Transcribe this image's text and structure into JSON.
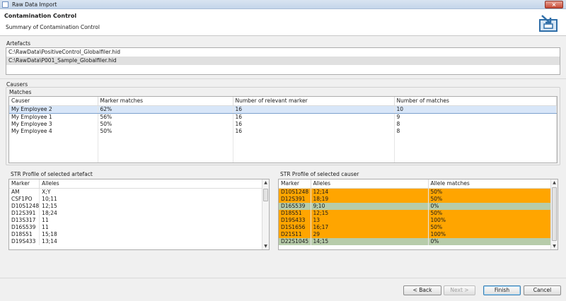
{
  "window": {
    "title": "Raw Data Import",
    "close_glyph": "×"
  },
  "header": {
    "title": "Contamination Control",
    "subtitle": "Summary of Contamination Control",
    "icon": "import-wizard-icon"
  },
  "artefacts": {
    "label": "Artefacts",
    "items": [
      "C:\\RawData\\PositiveControl_Globalfiler.hid",
      "C:\\RawData\\P001_Sample_Globalfiler.hid"
    ]
  },
  "causers": {
    "label": "Causers",
    "matches_label": "Matches",
    "columns": [
      "Causer",
      "Marker matches",
      "Number of relevant marker",
      "Number of matches"
    ],
    "rows": [
      [
        "My Employee 2",
        "62%",
        "16",
        "10"
      ],
      [
        "My Employee 1",
        "56%",
        "16",
        "9"
      ],
      [
        "My Employee 3",
        "50%",
        "16",
        "8"
      ],
      [
        "My Employee 4",
        "50%",
        "16",
        "8"
      ]
    ]
  },
  "artefact_profile": {
    "label": "STR Profile of selected artefact",
    "columns": [
      "Marker",
      "Alleles"
    ],
    "rows": [
      [
        "AM",
        "X;Y"
      ],
      [
        "CSF1PO",
        "10;11"
      ],
      [
        "D10S1248",
        "12;15"
      ],
      [
        "D12S391",
        "18;24"
      ],
      [
        "D13S317",
        "11"
      ],
      [
        "D16S539",
        "11"
      ],
      [
        "D18S51",
        "15;18"
      ],
      [
        "D19S433",
        "13;14"
      ]
    ]
  },
  "causer_profile": {
    "label": "STR Profile of selected causer",
    "columns": [
      "Marker",
      "Alleles",
      "Allele matches"
    ],
    "rows": [
      [
        "D10S1248",
        "12;14",
        "50%"
      ],
      [
        "D12S391",
        "18;19",
        "50%"
      ],
      [
        "D16S539",
        "9;10",
        "0%"
      ],
      [
        "D18S51",
        "12;15",
        "50%"
      ],
      [
        "D19S433",
        "13",
        "100%"
      ],
      [
        "D1S1656",
        "16;17",
        "50%"
      ],
      [
        "D21S11",
        "29",
        "100%"
      ],
      [
        "D22S1045",
        "14;15",
        "0%"
      ]
    ],
    "row_colors": [
      "orange",
      "orange",
      "green",
      "orange",
      "orange",
      "orange",
      "orange",
      "green"
    ]
  },
  "colors": {
    "match": "#ffa500",
    "no_match": "#b7ccaa",
    "selection": "#d8e6f8"
  },
  "buttons": {
    "back": "< Back",
    "next": "Next >",
    "finish": "Finish",
    "cancel": "Cancel"
  }
}
